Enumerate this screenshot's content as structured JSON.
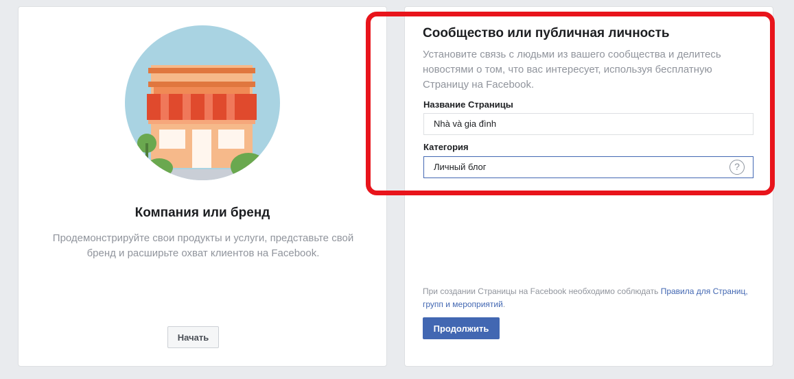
{
  "left_card": {
    "title": "Компания или бренд",
    "description": "Продемонстрируйте свои продукты и услуги, представьте свой бренд и расширьте охват клиентов на Facebook.",
    "start_button": "Начать"
  },
  "right_card": {
    "title": "Сообщество или публичная личность",
    "description": "Установите связь с людьми из вашего сообщества и делитесь новостями о том, что вас интересует, используя бесплатную Страницу на Facebook.",
    "page_name_label": "Название Страницы",
    "page_name_value": "Nhà và gia đình",
    "category_label": "Категория",
    "category_value": "Личный блог",
    "help_glyph": "?",
    "policy_text": "При создании Страницы на Facebook необходимо соблюдать ",
    "policy_link": "Правила для Страниц, групп и мероприятий",
    "policy_end": ".",
    "continue_button": "Продолжить"
  },
  "colors": {
    "accent": "#4267b2",
    "highlight": "#e8141b"
  }
}
